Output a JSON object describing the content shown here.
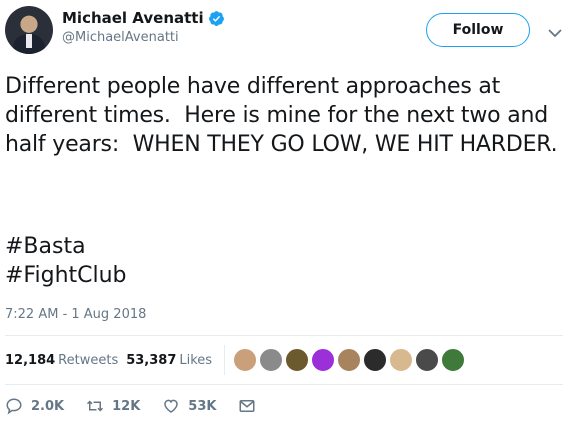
{
  "author": {
    "display_name": "Michael Avenatti",
    "handle": "@MichaelAvenatti",
    "verified": true
  },
  "follow_label": "Follow",
  "tweet": {
    "text": "Different people have different approaches at different times.  Here is mine for the next two and half years:  WHEN THEY GO LOW, WE HIT HARDER.",
    "hashtags": [
      "#Basta",
      "#FightClub"
    ],
    "timestamp": "7:22 AM - 1 Aug 2018"
  },
  "stats": {
    "retweets_count": "12,184",
    "retweets_label": "Retweets",
    "likes_count": "53,387",
    "likes_label": "Likes"
  },
  "likers": [
    "#c9a07a",
    "#8a8a8a",
    "#6b5a2e",
    "#9b30d9",
    "#a8845e",
    "#2b2b2b",
    "#d8b88e",
    "#4a4a4a",
    "#3f7a3a"
  ],
  "actions": {
    "replies": "2.0K",
    "retweets": "12K",
    "likes": "53K"
  },
  "colors": {
    "accent": "#1da1f2",
    "muted": "#657786",
    "text": "#14171a"
  }
}
